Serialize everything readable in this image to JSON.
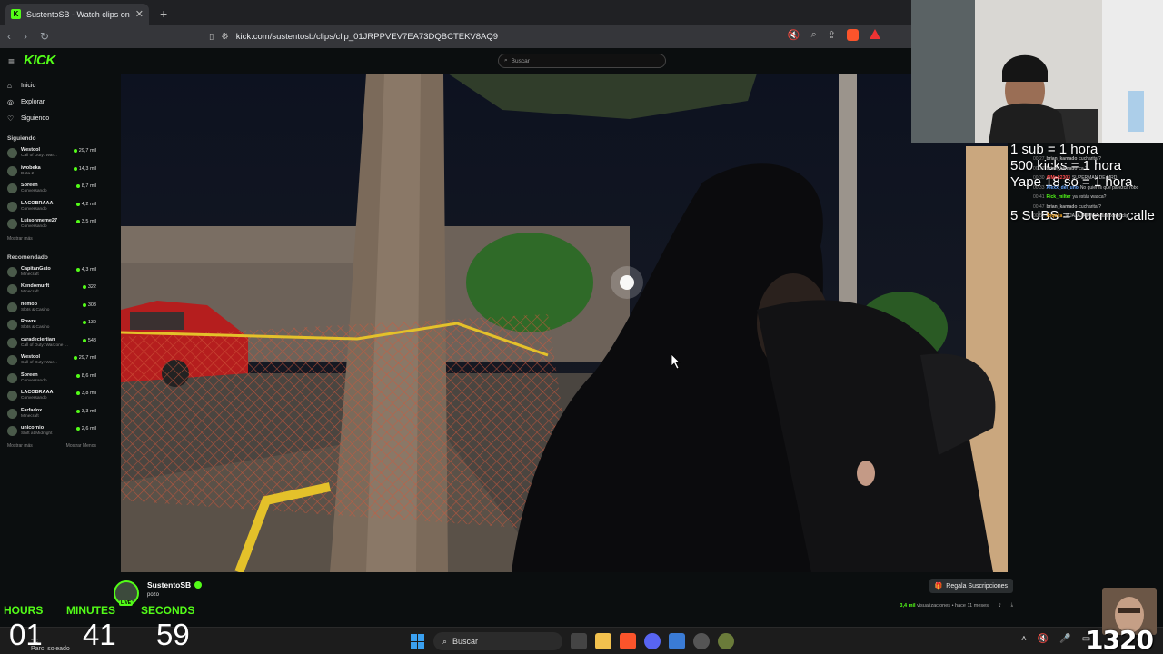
{
  "browser": {
    "tab_title": "SustentoSB - Watch clips on",
    "new_tab_symbol": "+",
    "url": "kick.com/sustentosb/clips/clip_01JRPPVEV7EA73DQBCTEKV8AQ9"
  },
  "kick": {
    "logo": "KICK",
    "search_placeholder": "Buscar",
    "nav": [
      {
        "label": "Inicio",
        "icon": "home-icon"
      },
      {
        "label": "Explorar",
        "icon": "compass-icon"
      },
      {
        "label": "Siguiendo",
        "icon": "heart-icon"
      }
    ],
    "following_title": "Siguiendo",
    "following": [
      {
        "name": "Westcol",
        "game": "Call of Duty: War...",
        "viewers": "29,7 mil"
      },
      {
        "name": "iwobeka",
        "game": "Dota 2",
        "viewers": "14,3 mil"
      },
      {
        "name": "Spreen",
        "game": "Conversando",
        "viewers": "8,7 mil"
      },
      {
        "name": "LACOBRAAA",
        "game": "Conversando",
        "viewers": "4,2 mil"
      },
      {
        "name": "Luisonmeme27",
        "game": "Conversando",
        "viewers": "3,5 mil"
      }
    ],
    "show_more": "Mostrar más",
    "recommended_title": "Recomendado",
    "recommended": [
      {
        "name": "CapitanGato",
        "game": "Minecraft",
        "viewers": "4,3 mil"
      },
      {
        "name": "Kendomurft",
        "game": "Minecraft",
        "viewers": "322"
      },
      {
        "name": "nemob",
        "game": "Slots & Casino",
        "viewers": "303"
      },
      {
        "name": "Rowre",
        "game": "Slots & Casino",
        "viewers": "130"
      },
      {
        "name": "caradeciertian",
        "game": "Call of Duty: Warzone ...",
        "viewers": "548"
      },
      {
        "name": "Westcol",
        "game": "Call of Duty: War...",
        "viewers": "29,7 mil"
      },
      {
        "name": "Spreen",
        "game": "Conversando",
        "viewers": "8,6 mil"
      },
      {
        "name": "LACOBRAAA",
        "game": "Conversando",
        "viewers": "3,8 mil"
      },
      {
        "name": "Farfadox",
        "game": "Minecraft",
        "viewers": "3,3 mil"
      },
      {
        "name": "unicornio",
        "game": "Shift at Midnight",
        "viewers": "2,6 mil"
      }
    ],
    "show_more2": "Mostrar más",
    "show_less": "Mostrar Menos",
    "streamer": {
      "name": "SustentoSB",
      "live_badge": "LIVE",
      "title": "pozo",
      "gift_label": "Regala Suscripciones",
      "views": "3,4 mil",
      "views_suffix": "visualizaciones",
      "time_ago": "• hace 11 meses"
    }
  },
  "overlay": {
    "line1": "1 sub = 1 hora",
    "line2": "500 kicks = 1 hora",
    "line3": "Yape 18 so = 1 hora",
    "line4": "5 SUBS = Duermo calle",
    "chat": [
      {
        "time": "00:27",
        "user": "brian_kamado",
        "text": "cucharita ?",
        "color": "#b0b0b0"
      },
      {
        "time": "00:27",
        "user": "brian_kamado",
        "text": "ca ?",
        "color": "#b0b0b0"
      },
      {
        "time": "00:30",
        "user": "AlMolt2303",
        "text": "SUPERMAN DE MRD",
        "color": "#ff4d4d"
      },
      {
        "time": "00:33",
        "user": "Alexx_del_uno",
        "text": "No quieres que parezca robo",
        "color": "#6aa8ff"
      },
      {
        "time": "00:41",
        "user": "Rick_milter",
        "text": "ya estás wasca?",
        "color": "#53fc18"
      },
      {
        "time": "00:47",
        "user": "brian_kamado",
        "text": "cucharita ?",
        "color": "#b0b0b0"
      },
      {
        "time": "00:52",
        "user": "Joquita",
        "text": "JAJAJAJAJA! gracias por el clip",
        "color": "#f5a623"
      }
    ]
  },
  "timer": {
    "hours_label": "HOURS",
    "minutes_label": "MINUTES",
    "seconds_label": "SECONDS",
    "hours": "01",
    "minutes": "41",
    "seconds": "59"
  },
  "taskbar": {
    "weather_temp": "°C",
    "weather_desc": "Parc. soleado",
    "search_label": "Buscar",
    "badge": "1320"
  },
  "colors": {
    "kick_green": "#53fc18",
    "background": "#0b0e0f"
  }
}
